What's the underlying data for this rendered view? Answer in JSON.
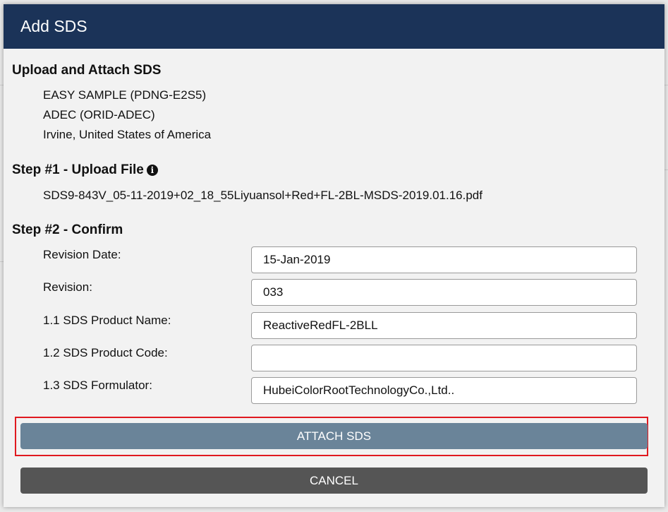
{
  "dialog": {
    "title": "Add SDS"
  },
  "upload_section": {
    "heading": "Upload and Attach SDS",
    "lines": [
      "EASY SAMPLE (PDNG-E2S5)",
      "ADEC (ORID-ADEC)",
      "Irvine, United States of America"
    ]
  },
  "step1": {
    "heading": "Step #1 - Upload File",
    "info_icon": "info-circle-icon",
    "filename": "SDS9-843V_05-11-2019+02_18_55Liyuansol+Red+FL-2BL-MSDS-2019.01.16.pdf"
  },
  "step2": {
    "heading": "Step #2 - Confirm",
    "fields": [
      {
        "label": "Revision Date:",
        "value": "15-Jan-2019"
      },
      {
        "label": "Revision:",
        "value": "033"
      },
      {
        "label": "1.1 SDS Product Name:",
        "value": "ReactiveRedFL-2BLL"
      },
      {
        "label": "1.2 SDS Product Code:",
        "value": ""
      },
      {
        "label": "1.3 SDS Formulator:",
        "value": "HubeiColorRootTechnologyCo.,Ltd.."
      }
    ]
  },
  "actions": {
    "attach_label": "ATTACH SDS",
    "cancel_label": "CANCEL"
  },
  "colors": {
    "header_bg": "#1b3358",
    "attach_bg": "#6a8499",
    "cancel_bg": "#555555",
    "highlight": "#e0191f"
  }
}
